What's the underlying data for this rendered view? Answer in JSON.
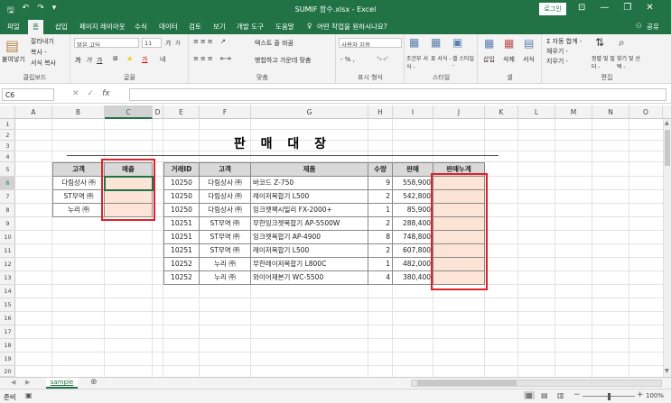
{
  "window": {
    "title": "SUMIF 함수.xlsx - Excel",
    "login_label": "로그인",
    "minimize": "—",
    "restore": "❐",
    "close": "✕",
    "ribbon_display": "⊡"
  },
  "qat": {
    "save": "🖫",
    "undo": "↶",
    "redo": "↷",
    "customize": "▾"
  },
  "tabs": [
    "파일",
    "홈",
    "삽입",
    "페이지 레이아웃",
    "수식",
    "데이터",
    "검토",
    "보기",
    "개발 도구",
    "도움말"
  ],
  "tell_me": "어떤 작업을 원하시나요?",
  "share": "공유",
  "ribbon": {
    "paste": "붙여넣기",
    "cut": "잘라내기",
    "copy": "복사 -",
    "format_painter": "서식 복사",
    "clipboard": "클립보드",
    "font_name": "맑은 고딕",
    "font_size": "11",
    "font_group": "글꼴",
    "bold": "가",
    "italic": "가",
    "underline": "가",
    "grow_font": "가",
    "shrink_font": "가",
    "text_wrap": "텍스트 줄 바꿈",
    "merge_center": "병합하고 가운데 맞춤",
    "align_group": "맞춤",
    "number_format": "사용자 지정",
    "number_group": "표시 형식",
    "number_symbols": "- % ,",
    "decimal_buttons": "⁺₀ ₀⁺",
    "cond_format": "조건부 서식 -",
    "format_table": "표 서식 -",
    "cell_styles": "셀 스타일 -",
    "style_group": "스타일",
    "insert": "삽입",
    "delete": "삭제",
    "format": "서식",
    "cells_group": "셀",
    "autosum": "Σ 자동 합계 -",
    "fill": "채우기 -",
    "clear": "지우기 -",
    "sort_filter": "정렬 및 필터 -",
    "find_select": "찾기 및 선택 -",
    "edit_group": "편집"
  },
  "formula_bar": {
    "name_box": "C6",
    "fx": "fx",
    "formula": "",
    "cancel": "✕",
    "enter": "✓"
  },
  "columns": [
    "A",
    "B",
    "C",
    "D",
    "E",
    "F",
    "G",
    "H",
    "I",
    "J",
    "K",
    "L",
    "M",
    "N",
    "O"
  ],
  "rows": [
    "1",
    "2",
    "3",
    "4",
    "5",
    "6",
    "7",
    "8",
    "9",
    "10",
    "11",
    "12",
    "13",
    "14",
    "15",
    "16",
    "17",
    "18",
    "19",
    "20"
  ],
  "sheet": {
    "title": "판 매 대 장",
    "left_headers": [
      "고객",
      "매출"
    ],
    "left_rows": [
      [
        "다림상사 ㈜",
        ""
      ],
      [
        "ST무역 ㈜",
        ""
      ],
      [
        "누리 ㈜",
        ""
      ]
    ],
    "main_headers": [
      "거래ID",
      "고객",
      "제품",
      "수량",
      "판매",
      "판매누계"
    ],
    "main_rows": [
      [
        "10250",
        "다림상사 ㈜",
        "바코드 Z-750",
        "9",
        "558,900",
        ""
      ],
      [
        "10250",
        "다림상사 ㈜",
        "레이저복합기 L500",
        "2",
        "542,800",
        ""
      ],
      [
        "10250",
        "다림상사 ㈜",
        "잉크젯팩시밀리 FX-2000+",
        "1",
        "85,900",
        ""
      ],
      [
        "10251",
        "ST무역 ㈜",
        "무한잉크젯복합기 AP-5500W",
        "2",
        "288,400",
        ""
      ],
      [
        "10251",
        "ST무역 ㈜",
        "잉크젯복합기 AP-4900",
        "8",
        "748,800",
        ""
      ],
      [
        "10251",
        "ST무역 ㈜",
        "레이저복합기 L500",
        "2",
        "607,800",
        ""
      ],
      [
        "10252",
        "누리 ㈜",
        "무한레이저복합기 L800C",
        "1",
        "482,000",
        ""
      ],
      [
        "10252",
        "누리 ㈜",
        "와이어제본기 WC-5500",
        "4",
        "380,400",
        ""
      ]
    ]
  },
  "sheet_tab": "sample",
  "status": {
    "ready": "준비",
    "zoom": "100%"
  },
  "colors": {
    "excel_green": "#217346",
    "highlight_fill": "#fce4d6",
    "header_fill": "#d9d9d9",
    "annotation_red": "#e0202a"
  }
}
